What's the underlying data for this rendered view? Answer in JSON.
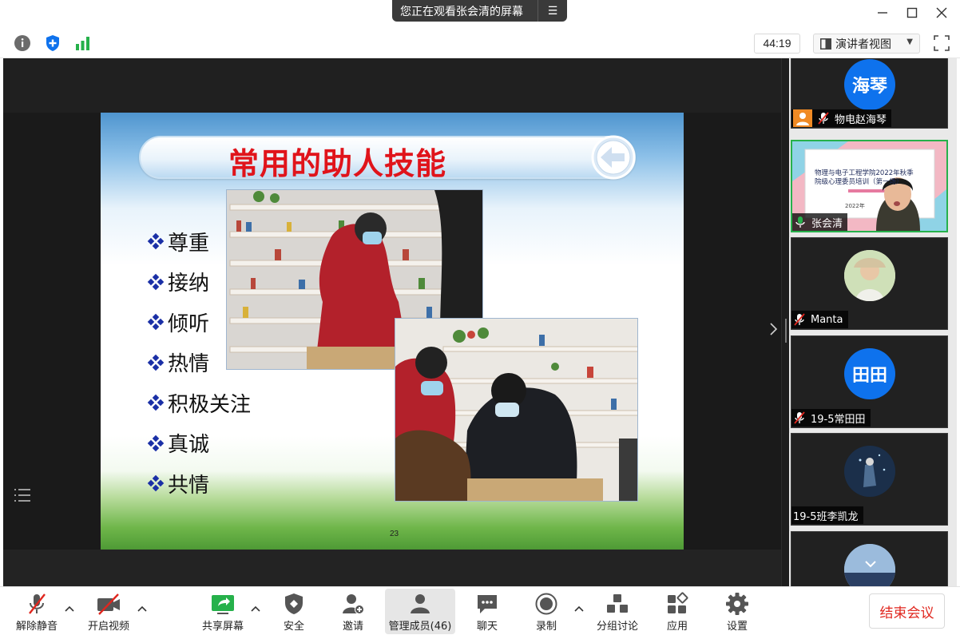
{
  "window": {
    "share_banner": "您正在观看张会清的屏幕",
    "share_menu_icon": "list-menu-icon"
  },
  "toolbar": {
    "timer": "44:19",
    "view_mode": "演讲者视图"
  },
  "slide": {
    "title": "常用的助人技能",
    "bullets": [
      "尊重",
      "接纳",
      "倾听",
      "热情",
      "积极关注",
      "真诚",
      "共情"
    ],
    "page_number": "23",
    "title_color": "#e0141b"
  },
  "participants": [
    {
      "avatar_text": "海琴",
      "name": "物电赵海琴",
      "muted": true,
      "avatar_color": "#0e72ed"
    },
    {
      "name": "张会清",
      "muted": false,
      "active_speaker": true,
      "screen_text_line1": "物理与电子工程学院2022年秋季",
      "screen_text_line2": "院级心理委员培训（第一场）",
      "screen_text_line3": "2022年"
    },
    {
      "name": "Manta",
      "muted": true
    },
    {
      "avatar_text": "田田",
      "name": "19-5常田田",
      "muted": true,
      "avatar_color": "#0e72ed"
    },
    {
      "name": "19-5班李凯龙",
      "muted": false
    }
  ],
  "controls": {
    "unmute": "解除静音",
    "start_video": "开启视频",
    "share_screen": "共享屏幕",
    "security": "安全",
    "invite": "邀请",
    "participants": "管理成员(46)",
    "chat": "聊天",
    "record": "录制",
    "breakout": "分组讨论",
    "apps": "应用",
    "settings": "设置",
    "end_meeting": "结束会议"
  },
  "colors": {
    "accent_green": "#26b14b",
    "end_red": "#e0261e",
    "avatar_blue": "#0e72ed"
  }
}
